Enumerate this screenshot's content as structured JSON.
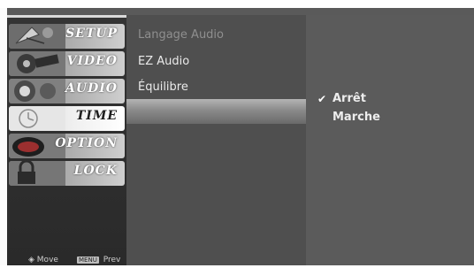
{
  "setup_menu": {
    "items": [
      {
        "label": "SETUP",
        "icon": "satellite-dish-icon",
        "active": false
      },
      {
        "label": "VIDEO",
        "icon": "film-reel-icon",
        "active": false
      },
      {
        "label": "AUDIO",
        "icon": "speaker-icon",
        "active": false
      },
      {
        "label": "TIME",
        "icon": "clock-icon",
        "active": true
      },
      {
        "label": "OPTION",
        "icon": "option-logo-icon",
        "active": false
      },
      {
        "label": "LOCK",
        "icon": "padlock-icon",
        "active": false
      }
    ],
    "hints": {
      "move_label": "Move",
      "prev_key": "MENU",
      "prev_label": "Prev"
    }
  },
  "submenu": {
    "items": [
      {
        "label": "Langage Audio",
        "enabled": false
      },
      {
        "label": "EZ Audio",
        "enabled": true
      },
      {
        "label": "Équilibre",
        "enabled": true
      }
    ]
  },
  "options": {
    "items": [
      {
        "label": "Arrêt",
        "checked": true
      },
      {
        "label": "Marche",
        "checked": false
      }
    ],
    "check_glyph": "✔"
  }
}
